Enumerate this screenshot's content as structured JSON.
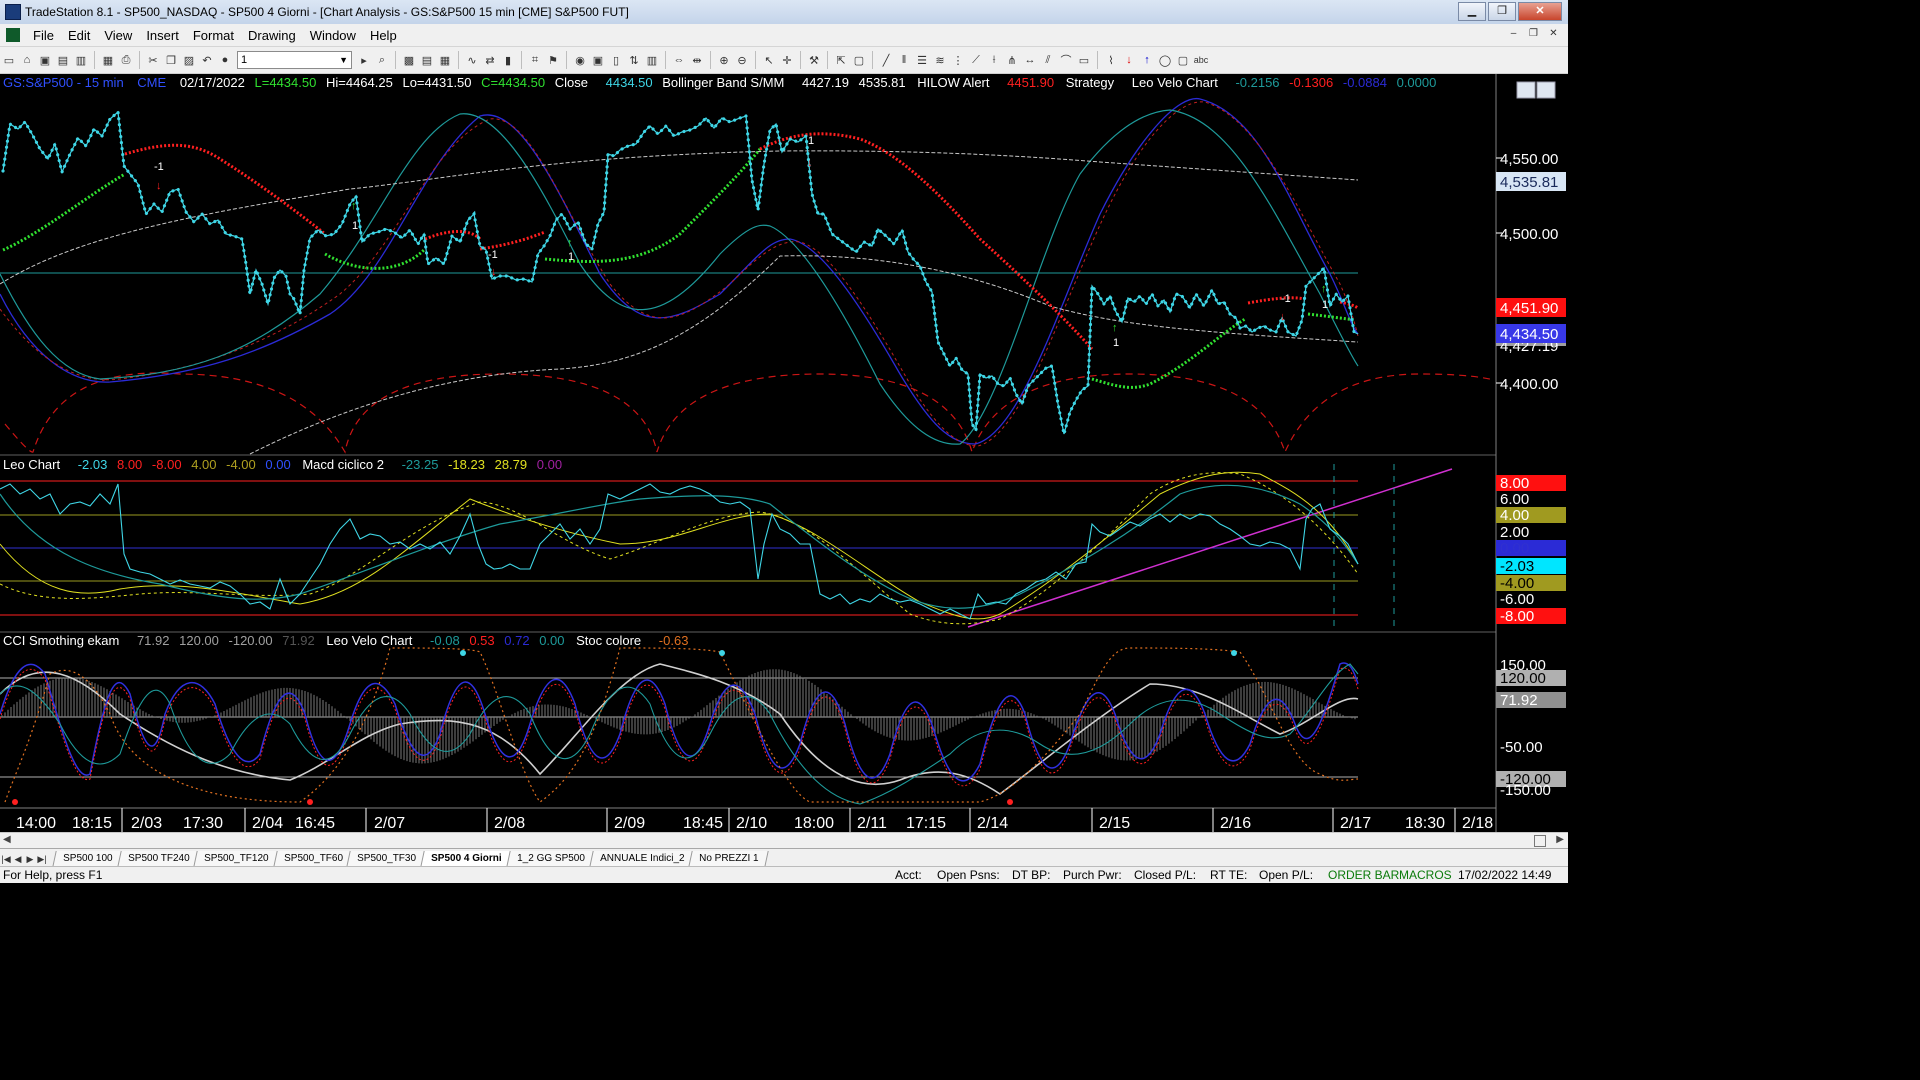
{
  "window": {
    "title": "TradeStation 8.1 - SP500_NASDAQ - SP500 4 Giorni - [Chart Analysis - GS:S&P500  15 min  [CME] S&P500 FUT]",
    "min_label": "▁",
    "max_label": "❐",
    "close_label": "✕"
  },
  "menu": {
    "items": [
      "File",
      "Edit",
      "View",
      "Insert",
      "Format",
      "Drawing",
      "Window",
      "Help"
    ],
    "mdi_min": "–",
    "mdi_restore": "❐",
    "mdi_close": "✕"
  },
  "toolbar": {
    "interval_value": "1",
    "interval_arrow": "▼"
  },
  "header_main": {
    "symbol": "GS:S&P500 - 15 min",
    "exchange": "CME",
    "date": "02/17/2022",
    "last": "L=4434.50",
    "hi": "Hi=4464.25",
    "lo": "Lo=4431.50",
    "close": "C=4434.50",
    "close_label": "Close",
    "close_value": "4434.50",
    "bb_label": "Bollinger Band S/MM",
    "bb_v1": "4427.19",
    "bb_v2": "4535.81",
    "hilow_label": "HILOW Alert",
    "hilow_value": "4451.90",
    "strategy_label": "Strategy",
    "velo_label": "Leo Velo Chart",
    "velo_v1": "-0.2156",
    "velo_v2": "-0.1306",
    "velo_v3": "-0.0884",
    "velo_v4": "0.0000"
  },
  "header_mid": {
    "leo_label": "Leo Chart",
    "v1": "-2.03",
    "v2": "8.00",
    "v3": "-8.00",
    "v4": "4.00",
    "v5": "-4.00",
    "v6": "0.00",
    "macd_label": "Macd ciclico 2",
    "m1": "-23.25",
    "m2": "-18.23",
    "m3": "28.79",
    "m4": "0.00"
  },
  "header_low": {
    "cci_label": "CCI Smothing ekam",
    "c1": "71.92",
    "c2": "120.00",
    "c3": "-120.00",
    "c4": "71.92",
    "velo_label": "Leo Velo Chart",
    "v1": "-0.08",
    "v2": "0.53",
    "v3": "0.72",
    "v4": "0.00",
    "stoc_label": "Stoc colore",
    "s1": "-0.63"
  },
  "axis_main": [
    "4,550.00",
    "4,500.00",
    "4,400.00"
  ],
  "axis_main_markers": {
    "bb_upper": "4,535.81",
    "hilow": "4,451.90",
    "close": "4,434.50",
    "bb_lower": "4,427.19"
  },
  "axis_mid": {
    "p8": "8.00",
    "p6": "6.00",
    "p4": "4.00",
    "p2": "2.00",
    "z": "0.00",
    "cur": "-2.03",
    "m4": "-4.00",
    "m6": "-6.00",
    "m8": "-8.00"
  },
  "axis_low": {
    "p150": "150.00",
    "p120": "120.00",
    "cur": "71.92",
    "m50": "-50.00",
    "m120": "-120.00",
    "m150": "-150.00"
  },
  "time_labels": [
    "14:00",
    "18:15",
    "2/03",
    "17:30",
    "2/04",
    "16:45",
    "2/07",
    "2/08",
    "2/09",
    "18:45",
    "2/10",
    "18:00",
    "2/11",
    "17:15",
    "2/14",
    "2/15",
    "2/16",
    "2/17",
    "18:30",
    "2/18"
  ],
  "signals": {
    "s1": "-1",
    "s2": "1",
    "s3": "-1",
    "s4": "1",
    "s5": "1",
    "s6": "1",
    "s7": "-1",
    "s8": "1"
  },
  "tabs": [
    "SP500 100",
    "SP500 TF240",
    "SP500_TF120",
    "SP500_TF60",
    "SP500_TF30",
    "SP500 4 Giorni",
    "1_2 GG SP500",
    "ANNUALE Indici_2",
    "No PREZZI 1"
  ],
  "tab_nav": [
    "|◀",
    "◀",
    "▶",
    "▶|"
  ],
  "status": {
    "help": "For Help, press F1",
    "acct": "Acct:",
    "open_psns": "Open Psns:",
    "dt_bp": "DT BP:",
    "purch_pwr": "Purch Pwr:",
    "closed_pl": "Closed P/L:",
    "rt_te": "RT TE:",
    "open_pl": "Open P/L:",
    "order_bar": "ORDER BAR",
    "macros": "MACROS",
    "datetime": "17/02/2022 14:49"
  },
  "colors": {
    "cyan": "#3fd6e6",
    "red": "#ff2020",
    "green": "#30e030",
    "blue": "#2b2bd6",
    "teal": "#1e9a9a",
    "yellow": "#e0e020",
    "magenta": "#d030d0"
  }
}
